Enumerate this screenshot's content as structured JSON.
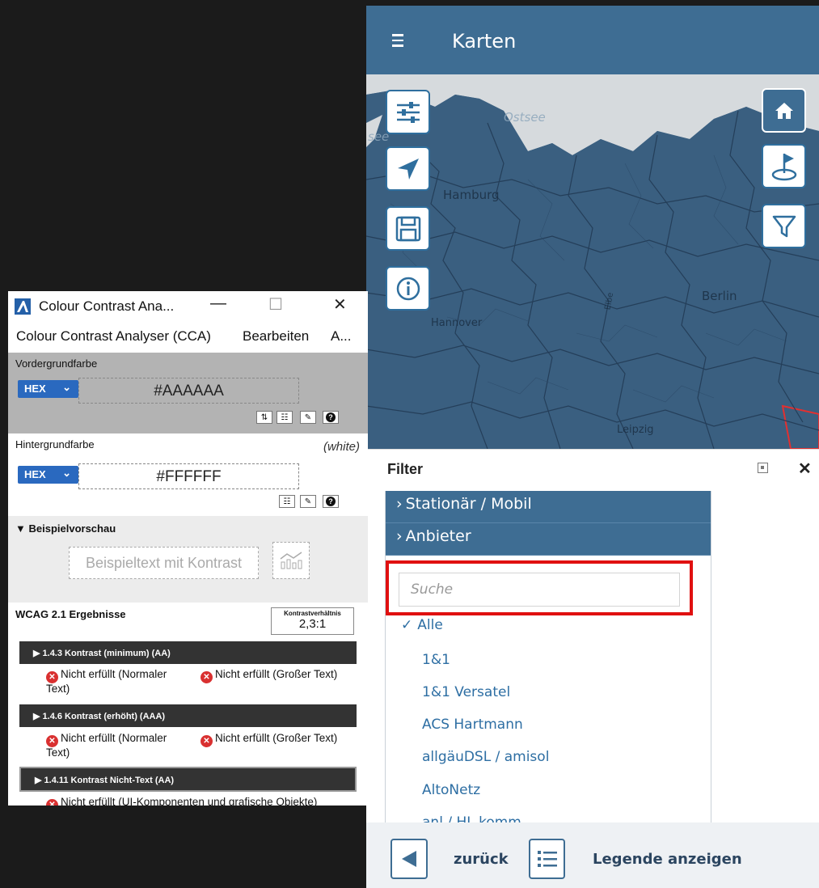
{
  "map_app": {
    "header": {
      "title": "Karten"
    },
    "map_labels": {
      "ostsee": "Ostsee",
      "see": "see",
      "hamburg": "Hamburg",
      "berlin": "Berlin",
      "hannover": "Hannover",
      "elbe": "Elbe",
      "leipzig": "Leipzig"
    },
    "map_buttons_left": [
      "sliders-icon",
      "locate-arrow-icon",
      "save-icon",
      "info-icon"
    ],
    "map_buttons_right": [
      "home-icon",
      "flag-pin-icon",
      "filter-icon"
    ],
    "filter": {
      "title": "Filter",
      "close_glyph": "✕",
      "accordions": [
        {
          "label": "Stationär / Mobil"
        },
        {
          "label": "Anbieter"
        }
      ],
      "search_placeholder": "Suche",
      "options": [
        {
          "label": "Alle",
          "checked": true
        },
        {
          "label": "1&1"
        },
        {
          "label": "1&1 Versatel"
        },
        {
          "label": "ACS Hartmann"
        },
        {
          "label": "allgäuDSL / amisol"
        },
        {
          "label": "AltoNetz"
        },
        {
          "label": "anl / HL komm"
        }
      ]
    },
    "bottom_bar": {
      "back_label": "zurück",
      "legend_label": "Legende anzeigen"
    },
    "colors": {
      "primary": "#3e6d93",
      "map_fill": "#3a5f80",
      "highlight": "#e01010",
      "link": "#2d6ea3"
    }
  },
  "cca": {
    "window_title": "Colour Contrast Ana...",
    "window_controls": {
      "minimize": "—",
      "maximize": "☐",
      "close": "✕"
    },
    "menu": [
      "Colour Contrast Analyser (CCA)",
      "Bearbeiten",
      "A..."
    ],
    "foreground": {
      "label": "Vordergrundfarbe",
      "format": "HEX",
      "value": "#AAAAAA"
    },
    "background": {
      "label": "Hintergrundfarbe",
      "note": "(white)",
      "format": "HEX",
      "value": "#FFFFFF"
    },
    "preview": {
      "toggle": "▼ Beispielvorschau",
      "sample_text": "Beispieltext mit Kontrast"
    },
    "results": {
      "title": "WCAG 2.1 Ergebnisse",
      "ratio_label": "Kontrastverhältnis",
      "ratio_value": "2,3:1",
      "criteria": [
        {
          "name": "▶ 1.4.3 Kontrast (minimum) (AA)",
          "normal": "Nicht erfüllt (Normaler Text)",
          "large": "Nicht erfüllt (Großer Text)"
        },
        {
          "name": "▶ 1.4.6 Kontrast (erhöht) (AAA)",
          "normal": "Nicht erfüllt (Normaler Text)",
          "large": "Nicht erfüllt (Großer Text)"
        },
        {
          "name": "▶ 1.4.11 Kontrast Nicht-Text (AA)",
          "ui": "Nicht erfüllt (UI-Komponenten und grafische Objekte)"
        }
      ]
    }
  }
}
